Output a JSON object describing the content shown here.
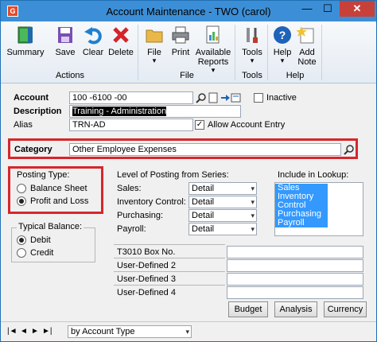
{
  "window": {
    "app_icon_text": "G",
    "title": "Account Maintenance  -  TWO (carol)",
    "minimize_label": "—",
    "maximize_label": "☐",
    "close_label": "✕"
  },
  "ribbon": {
    "actions": [
      {
        "label": "Summary",
        "icon": "summary-book-icon"
      },
      {
        "label": "Save",
        "icon": "save-icon"
      },
      {
        "label": "Clear",
        "icon": "undo-icon"
      },
      {
        "label": "Delete",
        "icon": "delete-x-icon"
      }
    ],
    "file": [
      {
        "label": "File",
        "icon": "folder-icon"
      },
      {
        "label": "Print",
        "icon": "printer-icon"
      },
      {
        "label": "Available Reports",
        "icon": "reports-icon"
      }
    ],
    "tools": [
      {
        "label": "Tools",
        "icon": "wrench-icon"
      }
    ],
    "help": [
      {
        "label": "Help",
        "icon": "help-icon"
      },
      {
        "label": "Add Note",
        "icon": "add-note-icon"
      }
    ],
    "groups": {
      "actions": "Actions",
      "file": "File",
      "tools": "Tools",
      "help": "Help"
    },
    "dropdown_mark": "▾"
  },
  "form": {
    "account_label": "Account",
    "account_value": "100 -6100 -00",
    "inactive_label": "Inactive",
    "description_label": "Description",
    "description_value": "Training - Administration",
    "alias_label": "Alias",
    "alias_value": "TRN-AD",
    "allow_entry_label": "Allow Account Entry",
    "allow_entry_checked": "✓",
    "category_label": "Category",
    "category_value": "Other Employee Expenses"
  },
  "posting_type": {
    "title": "Posting Type:",
    "options": [
      "Balance Sheet",
      "Profit and Loss"
    ],
    "selected": "Profit and Loss"
  },
  "typical_balance": {
    "title": "Typical Balance:",
    "options": [
      "Debit",
      "Credit"
    ],
    "selected": "Debit"
  },
  "level_of_posting": {
    "title": "Level of Posting from Series:",
    "rows": [
      {
        "label": "Sales:",
        "value": "Detail"
      },
      {
        "label": "Inventory Control:",
        "value": "Detail"
      },
      {
        "label": "Purchasing:",
        "value": "Detail"
      },
      {
        "label": "Payroll:",
        "value": "Detail"
      }
    ]
  },
  "include_in_lookup": {
    "title": "Include in Lookup:",
    "items": [
      "Sales",
      "Inventory Control",
      "Purchasing",
      "Payroll"
    ]
  },
  "user_fields": [
    "T3010 Box No.",
    "User-Defined 2",
    "User-Defined 3",
    "User-Defined 4"
  ],
  "buttons": {
    "budget": "Budget",
    "analysis": "Analysis",
    "currency": "Currency"
  },
  "bottom": {
    "nav": [
      "|◄",
      "◄",
      "►",
      "►|"
    ],
    "sort_value": "by Account Type"
  }
}
